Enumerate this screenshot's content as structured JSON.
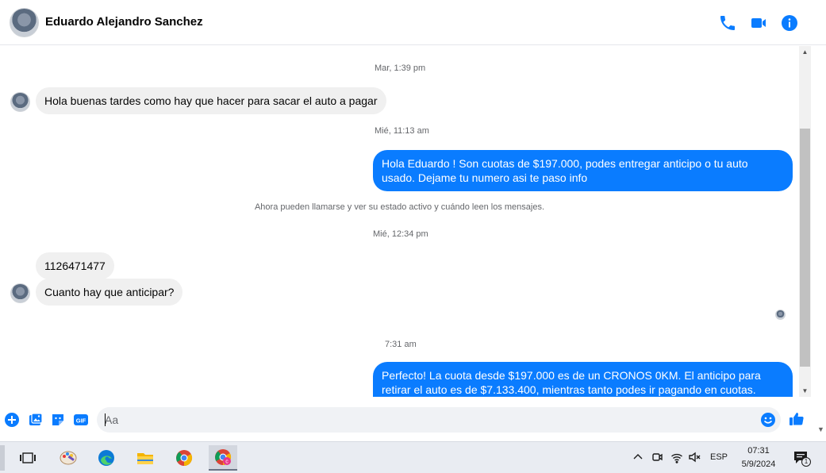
{
  "header": {
    "contact_name": "Eduardo Alejandro Sanchez",
    "icons": [
      "phone-icon",
      "video-camera-icon",
      "info-icon"
    ]
  },
  "conversation": {
    "timestamps": [
      "Mar, 1:39 pm",
      "Mié, 11:13 am",
      "Mié, 12:34 pm",
      "7:31 am"
    ],
    "notice": "Ahora pueden llamarse y ver su estado activo y cuándo leen los mensajes.",
    "messages": [
      {
        "direction": "incoming",
        "text": "Hola buenas tardes como hay que hacer para sacar el auto a pagar"
      },
      {
        "direction": "outgoing",
        "text": "Hola Eduardo ! Son cuotas de $197.000, podes entregar anticipo o tu auto usado. Dejame tu numero asi te paso info"
      },
      {
        "direction": "incoming",
        "text": "1126471477"
      },
      {
        "direction": "incoming",
        "text": "Cuanto hay que anticipar?"
      },
      {
        "direction": "outgoing",
        "text": "Perfecto! La cuota desde $197.000 es de un CRONOS 0KM. El anticipo para retirar el auto es de $7.133.400, mientras tanto podes ir pagando en cuotas. Cuándo podes"
      }
    ]
  },
  "composer": {
    "placeholder": "Aa",
    "icons": [
      "plus-icon",
      "image-icon",
      "sticker-icon",
      "gif-icon",
      "emoji-icon",
      "thumbs-up-icon"
    ],
    "gif_label": "GIF"
  },
  "taskbar": {
    "apps": [
      "task-view-icon",
      "paint-app-icon",
      "edge-browser-icon",
      "file-explorer-icon",
      "chrome-icon",
      "chrome-profile-icon"
    ],
    "language": "ESP",
    "time": "07:31",
    "date": "5/9/2024",
    "notification_count": "1"
  },
  "colors": {
    "accent": "#0a7cff",
    "incoming_bubble": "#f0f0f0",
    "taskbar": "#e9ecf2"
  }
}
